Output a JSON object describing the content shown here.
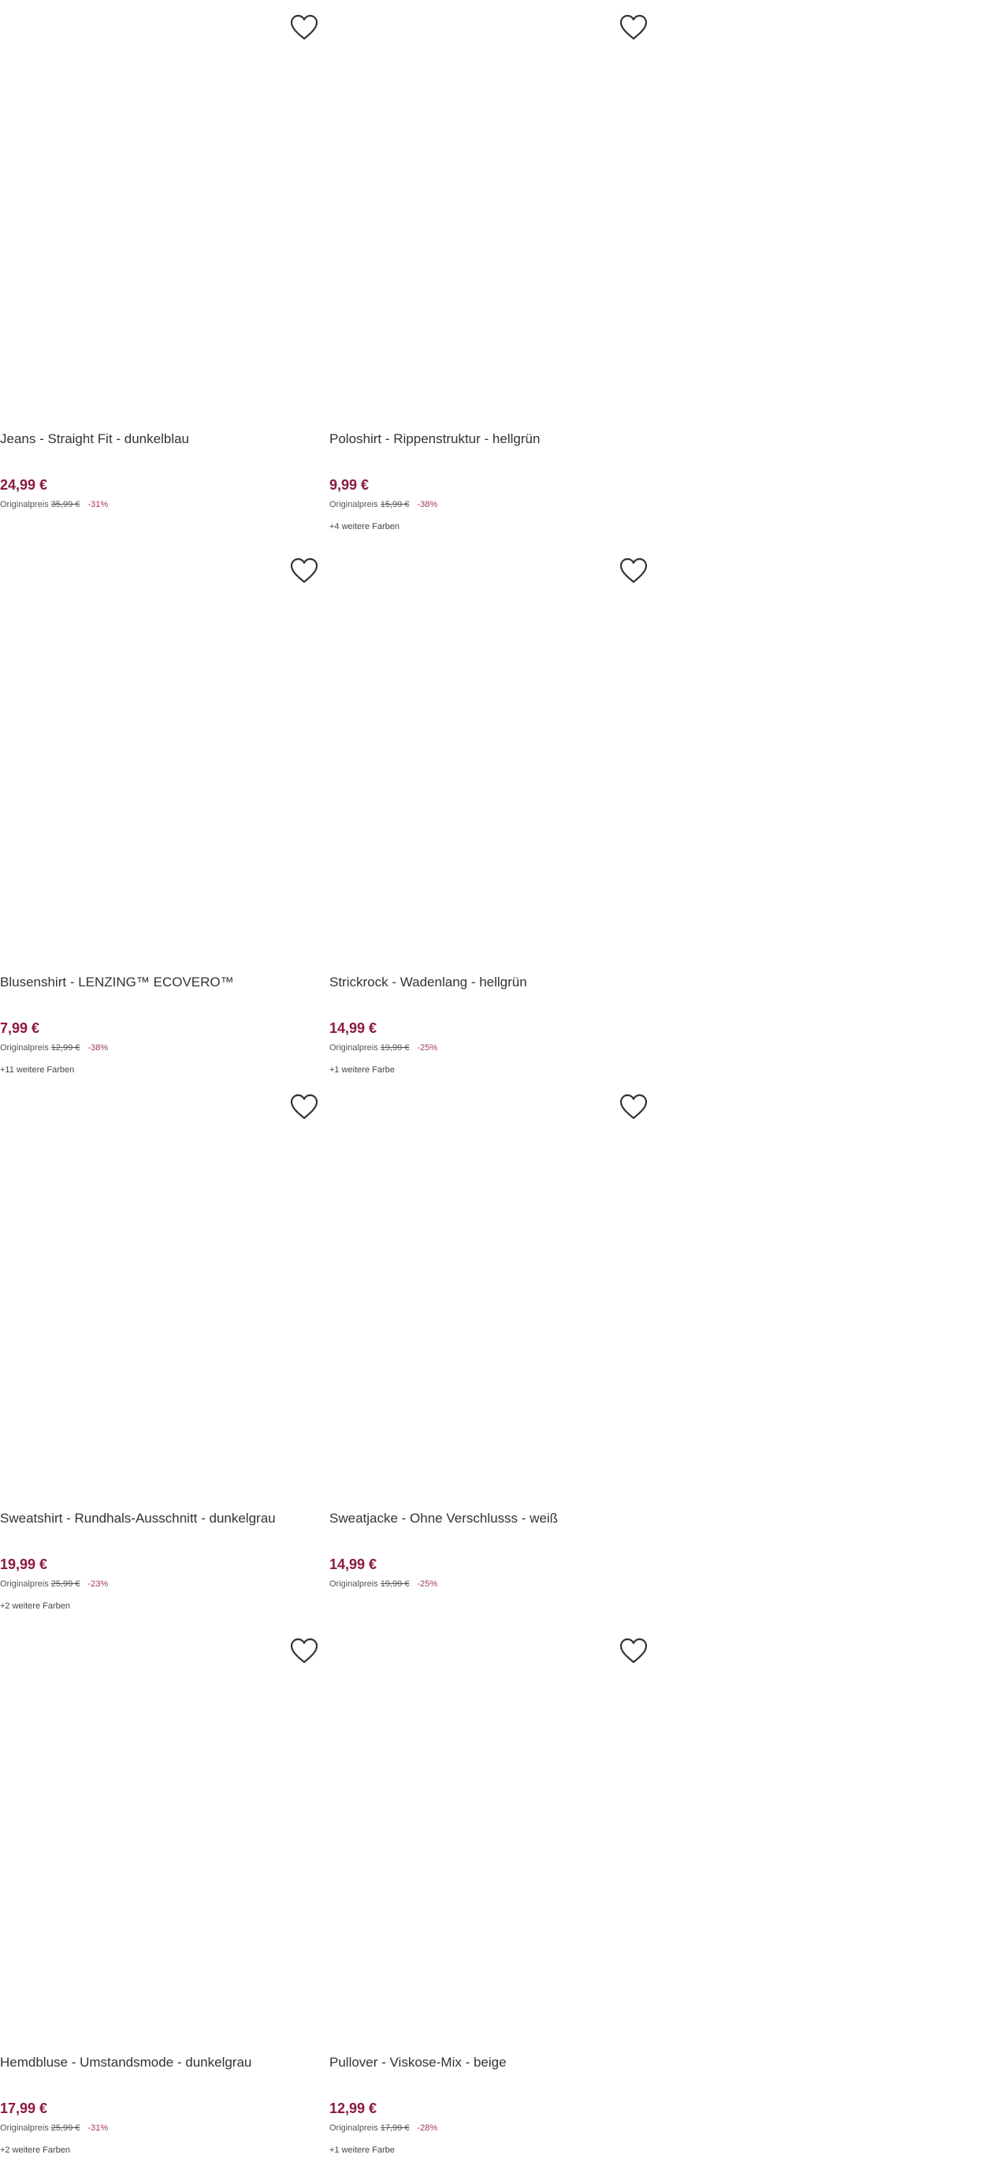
{
  "original_price_label": "Originalpreis",
  "products": [
    {
      "title": "Jeans - Straight Fit - dunkelblau",
      "price": "24,99 €",
      "original_price": "35,99 €",
      "discount": "-31%",
      "more_colors": ""
    },
    {
      "title": "Poloshirt - Rippenstruktur - hellgrün",
      "price": "9,99 €",
      "original_price": "15,99 €",
      "discount": "-38%",
      "more_colors": "+4 weitere Farben"
    },
    {
      "title": "Blusenshirt - LENZING™ ECOVERO™",
      "price": "7,99 €",
      "original_price": "12,99 €",
      "discount": "-38%",
      "more_colors": "+11 weitere Farben"
    },
    {
      "title": "Strickrock - Wadenlang - hellgrün",
      "price": "14,99 €",
      "original_price": "19,99 €",
      "discount": "-25%",
      "more_colors": "+1 weitere Farbe"
    },
    {
      "title": "Sweatshirt - Rundhals-Ausschnitt - dunkelgrau",
      "price": "19,99 €",
      "original_price": "25,99 €",
      "discount": "-23%",
      "more_colors": "+2 weitere Farben"
    },
    {
      "title": "Sweatjacke - Ohne Verschlusss - weiß",
      "price": "14,99 €",
      "original_price": "19,99 €",
      "discount": "-25%",
      "more_colors": ""
    },
    {
      "title": "Hemdbluse - Umstandsmode - dunkelgrau",
      "price": "17,99 €",
      "original_price": "25,99 €",
      "discount": "-31%",
      "more_colors": "+2 weitere Farben"
    },
    {
      "title": "Pullover - Viskose-Mix - beige",
      "price": "12,99 €",
      "original_price": "17,99 €",
      "discount": "-28%",
      "more_colors": "+1 weitere Farbe"
    }
  ],
  "icons": {
    "wishlist": "heart-outline-icon"
  },
  "colors": {
    "price": "#8c1a3e",
    "discount": "#a23a5a",
    "text": "#333333"
  }
}
